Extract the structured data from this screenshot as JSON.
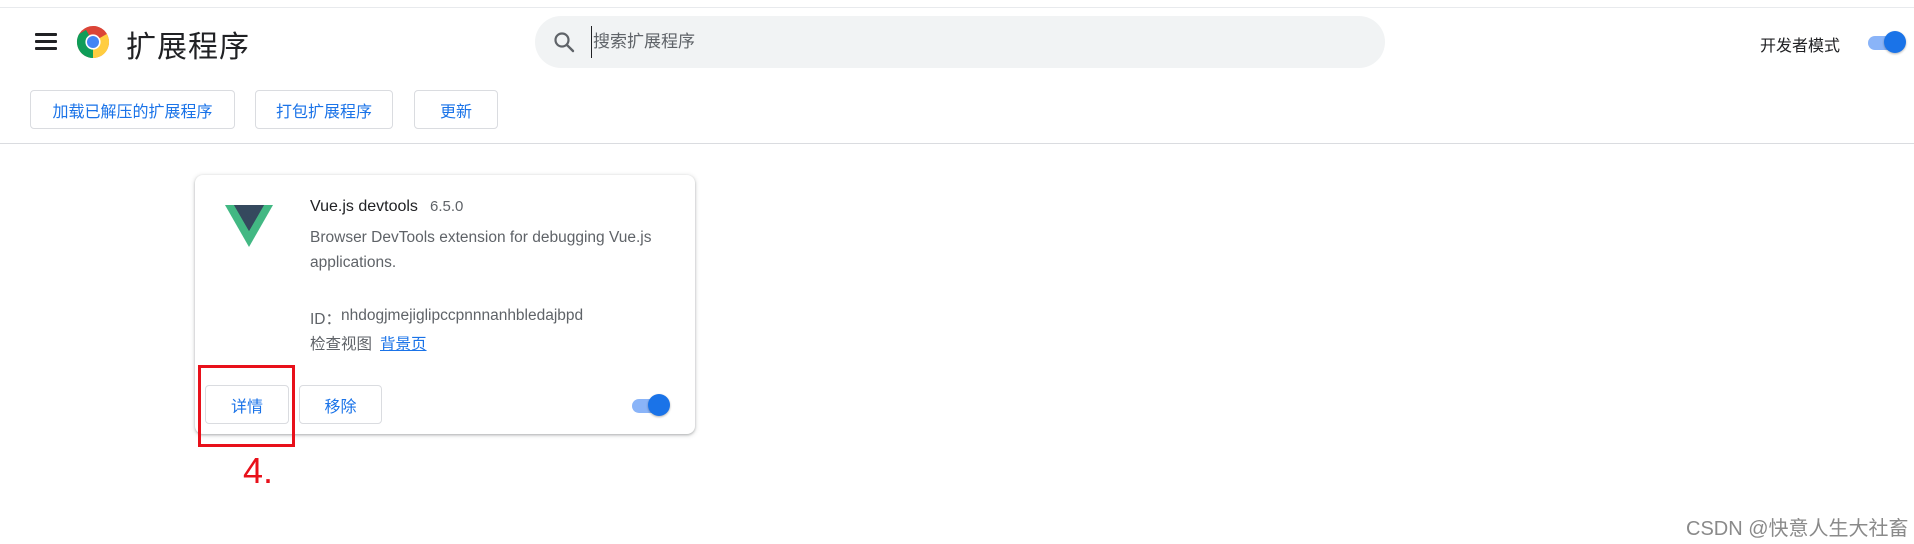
{
  "header": {
    "title": "扩展程序",
    "menu_icon": "hamburger-menu-icon",
    "logo_icon": "chrome-logo-icon",
    "search": {
      "placeholder": "搜索扩展程序",
      "value": "",
      "icon": "search-icon"
    },
    "dev_mode": {
      "label": "开发者模式",
      "enabled": true
    }
  },
  "toolbar": {
    "load_unpacked_label": "加载已解压的扩展程序",
    "pack_label": "打包扩展程序",
    "update_label": "更新"
  },
  "extension": {
    "name": "Vue.js devtools",
    "version": "6.5.0",
    "description": "Browser DevTools extension for debugging Vue.js applications.",
    "id_label": "ID：",
    "id": "nhdogjmejiglipccpnnnanhbledajbpd",
    "inspect_views_label": "检查视图",
    "inspect_views_link": "背景页",
    "details_label": "详情",
    "remove_label": "移除",
    "enabled": true,
    "icon": "vue-logo-icon"
  },
  "annotation": {
    "step_label": "4.",
    "color": "#e8101a"
  },
  "watermark": "CSDN @快意人生大社畜",
  "colors": {
    "accent": "#1a73e8",
    "toggle_track": "#8ab4f8",
    "search_bg": "#f1f3f4"
  }
}
